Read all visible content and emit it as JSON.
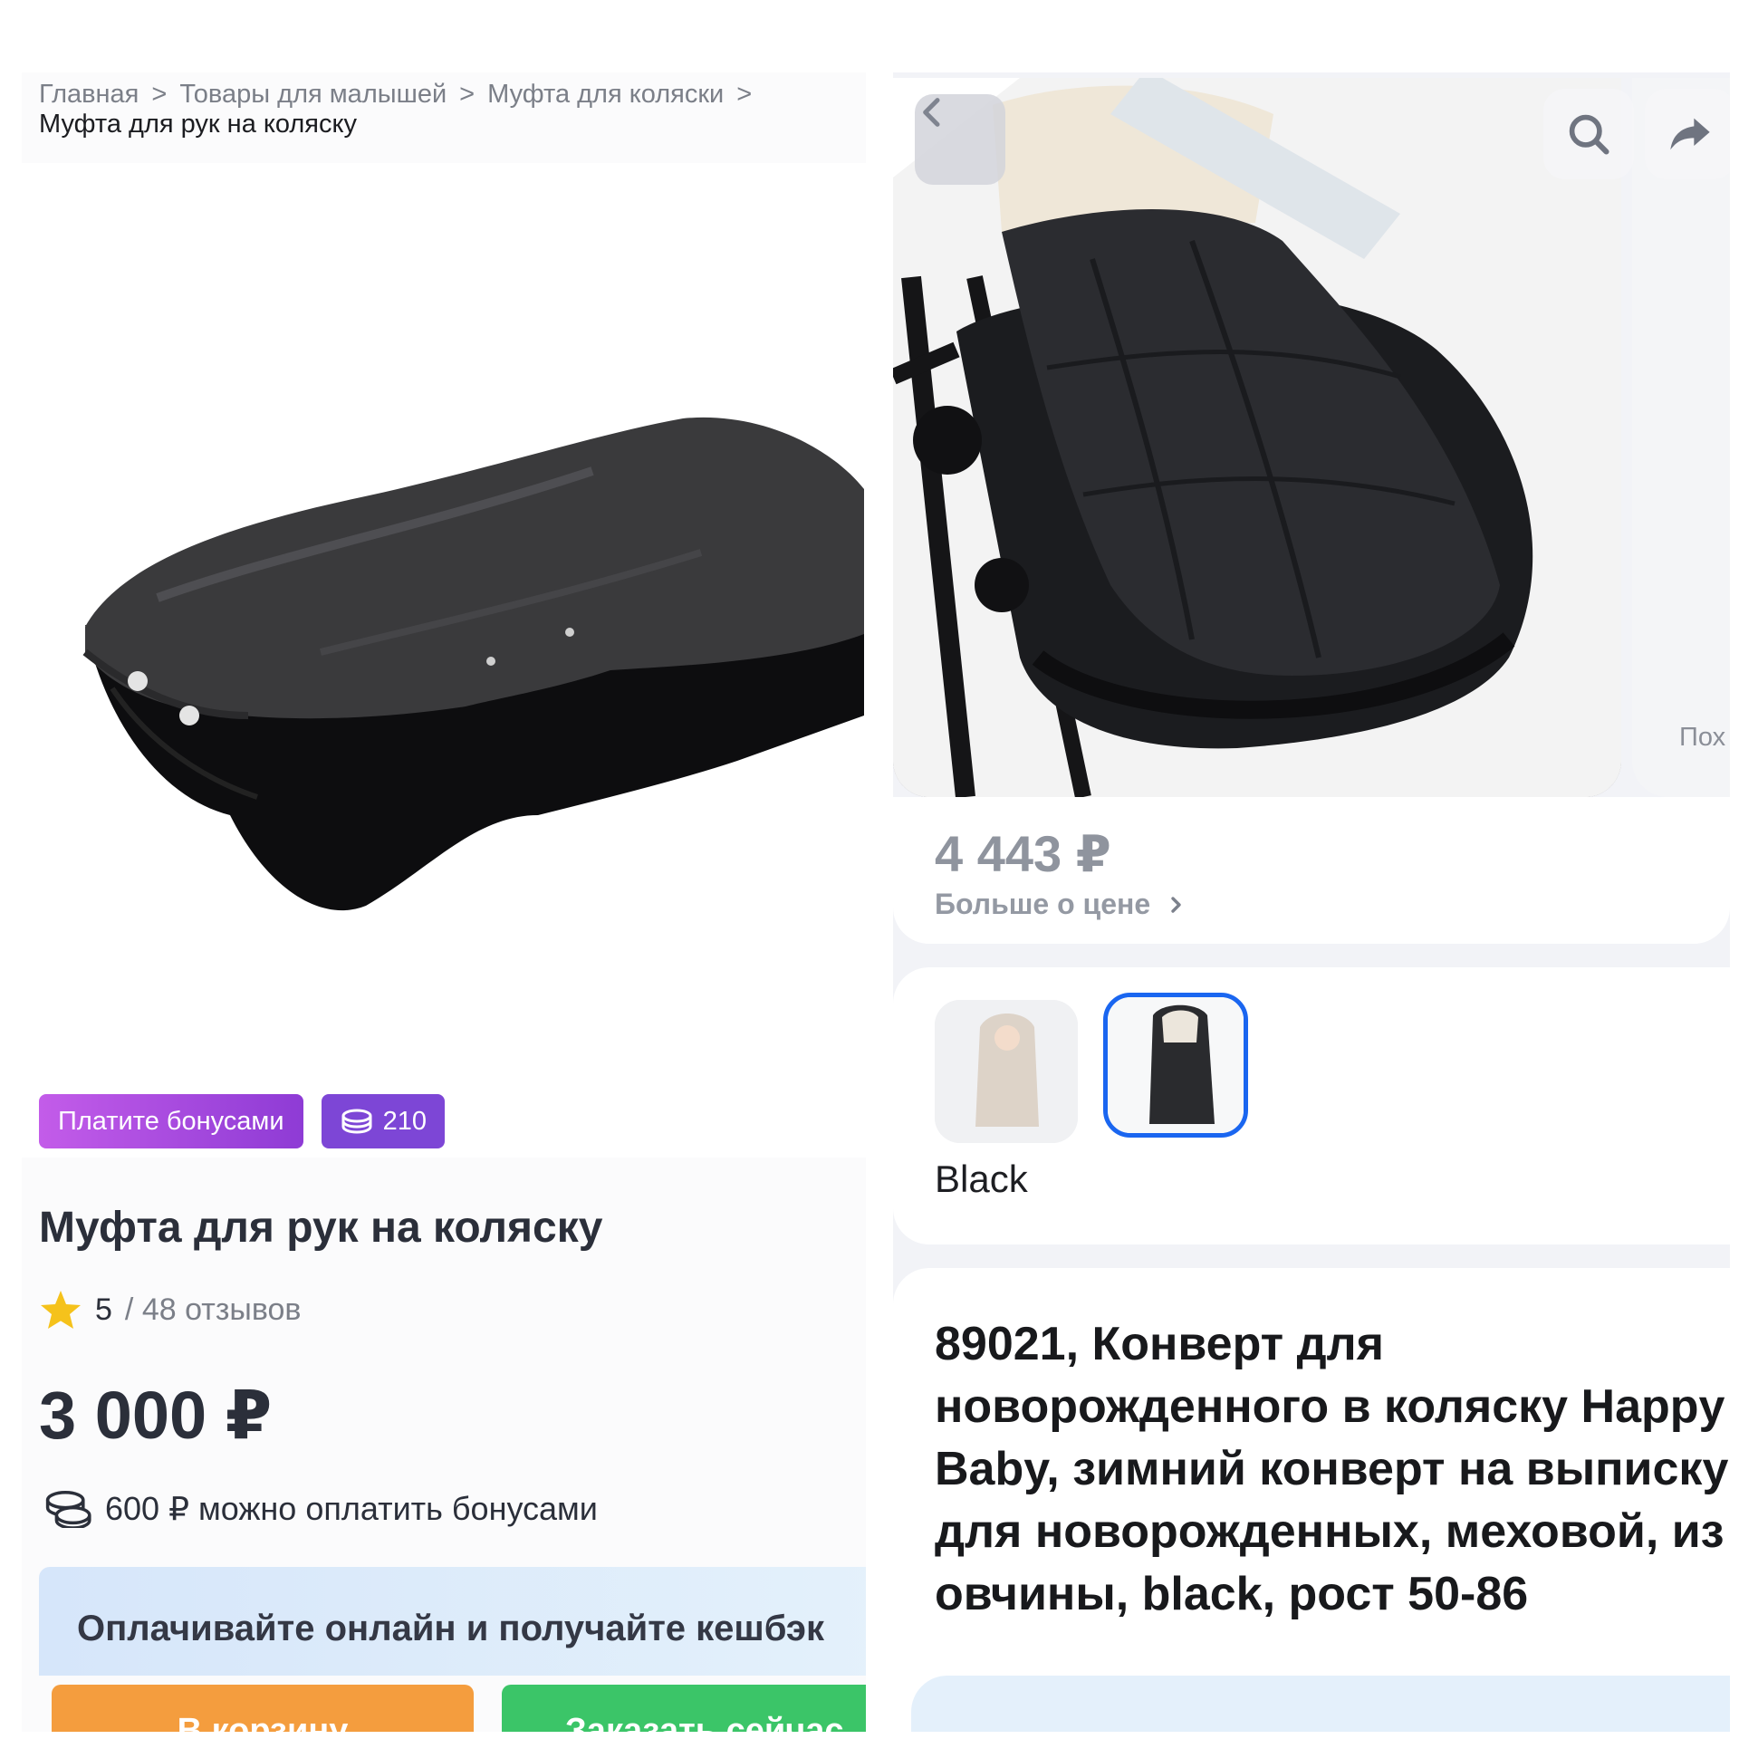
{
  "left": {
    "breadcrumbs": [
      "Главная",
      "Товары для малышей",
      "Муфта для коляски"
    ],
    "breadcrumb_separator": ">",
    "breadcrumb_current": "Муфта для рук на коляску",
    "badge_pay": "Платите бонусами",
    "badge_bonus": "210",
    "title": "Муфта для рук на коляску",
    "rating_score": "5",
    "rating_reviews": "/ 48 отзывов",
    "price": "3 000 ₽",
    "bonus_text": "600 ₽ можно оплатить бонусами",
    "cashback_text": "Оплачивайте онлайн и получайте кешбэк",
    "btn_cart": "В корзину",
    "btn_order": "Заказать сейчас"
  },
  "right": {
    "next_item_label": "Пох",
    "price": "4 443 ₽",
    "price_more": "Больше о цене",
    "selected_color": "Black",
    "title": "89021, Конверт для\nноворожденного в коляску Happy\nBaby, зимний конверт на выписку\nдля новорожденных, меховой, из\nовчины, black, рост 50-86"
  },
  "colors": {
    "star": "#f5c21b",
    "accent_purple": "#7d46d6",
    "cart_orange": "#f49d3e",
    "order_green": "#3bc568",
    "selected_border": "#1a66f0"
  },
  "icons": [
    "star-icon",
    "coins-icon",
    "chevron-left-icon",
    "search-icon",
    "share-icon",
    "chevron-right-icon"
  ]
}
